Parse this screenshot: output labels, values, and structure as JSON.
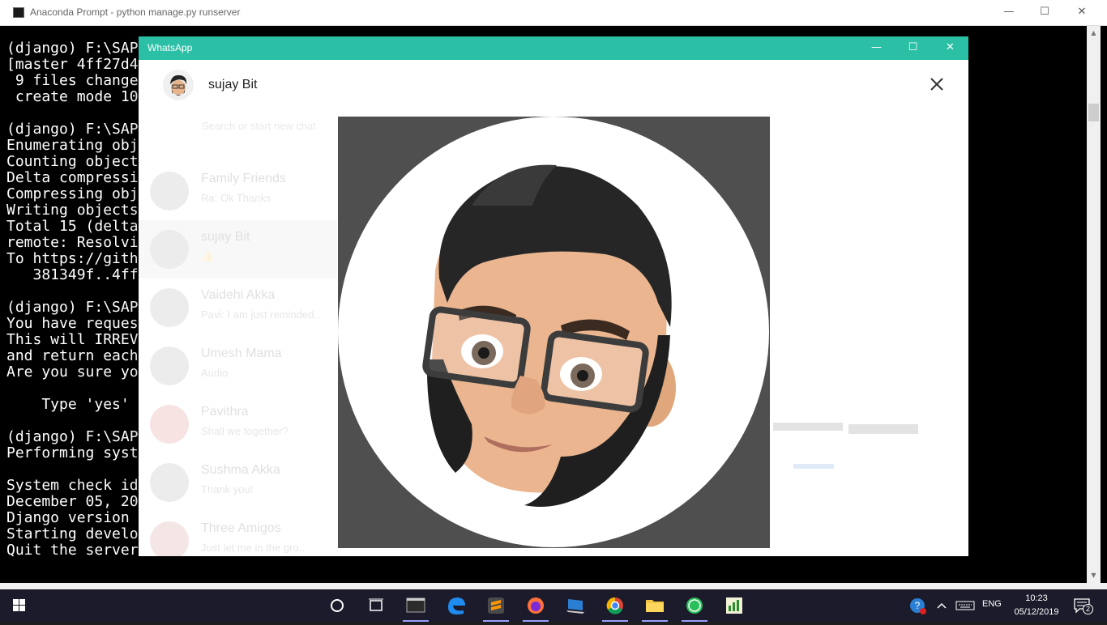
{
  "console": {
    "title": "Anaconda Prompt - python  manage.py runserver",
    "lines": [
      "(django) F:\\SAP",
      "[master 4ff27d4",
      " 9 files change",
      " create mode 10",
      "",
      "(django) F:\\SAP",
      "Enumerating obj",
      "Counting object",
      "Delta compressi",
      "Compressing obj",
      "Writing objects",
      "Total 15 (delta",
      "remote: Resolvi",
      "To https://gith",
      "   381349f..4ff",
      "",
      "(django) F:\\SAP",
      "You have reques",
      "This will IRREV",
      "and return each",
      "Are you sure yo",
      "",
      "    Type 'yes'",
      "",
      "(django) F:\\SAP",
      "Performing syst",
      "",
      "System check id",
      "December 05, 20",
      "Django version",
      "Starting develo",
      "Quit the server"
    ],
    "controls": {
      "minimize": "—",
      "maximize": "☐",
      "close": "✕"
    }
  },
  "whatsapp": {
    "title": "WhatsApp",
    "controls": {
      "minimize": "—",
      "maximize": "☐",
      "close": "✕"
    },
    "contact_name": "sujay Bit",
    "background": {
      "search_placeholder": "Search or start new chat",
      "chats": [
        {
          "name": "Family Friends",
          "preview": "Ra: Ok Thanks"
        },
        {
          "name": "sujay Bit",
          "preview": "👍"
        },
        {
          "name": "Vaidehi Akka",
          "preview": "Pavi: I am just reminded.."
        },
        {
          "name": "Umesh Mama",
          "preview": "Audio"
        },
        {
          "name": "Pavithra",
          "preview": "Shall we together?"
        },
        {
          "name": "Sushma Akka",
          "preview": "Thank you!"
        },
        {
          "name": "Three Amigos",
          "preview": "Just let me in the gro.."
        }
      ]
    }
  },
  "taskbar": {
    "lang": "ENG",
    "time": "10:23",
    "date": "05/12/2019",
    "notifications": "2",
    "accent_color": "#9aa0ff"
  }
}
